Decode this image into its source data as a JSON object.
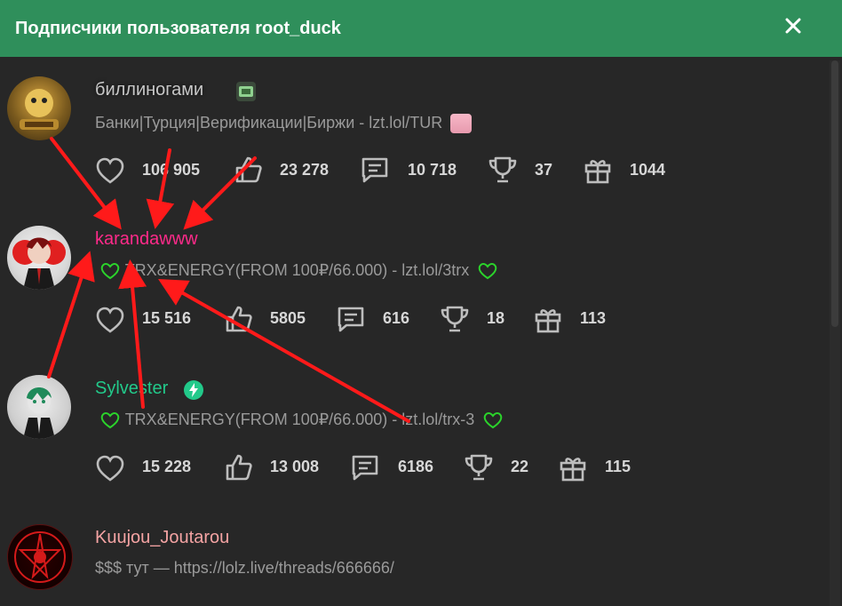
{
  "header": {
    "title": "Подписчики пользователя root_duck"
  },
  "colors": {
    "header_bg": "#2f8f5b",
    "name_gray": "#c8c8c8",
    "name_pink": "#ff2a8a",
    "name_green": "#22c98a",
    "name_salmon": "#f4a3a3",
    "stat_text": "#d7d7d7",
    "status_text": "#9a9a9a",
    "annotation_red": "#ff1a1a"
  },
  "users": [
    {
      "name": "биллиногами",
      "status": "Банки|Турция|Верификации|Биржи - lzt.lol/TUR",
      "stats": {
        "likes": "106 905",
        "thumbs": "23 278",
        "messages": "10 718",
        "trophies": "37",
        "gifts": "1044"
      }
    },
    {
      "name": "karandawww",
      "status": "TRX&ENERGY(FROM 100₽/66.000) - lzt.lol/3trx",
      "stats": {
        "likes": "15 516",
        "thumbs": "5805",
        "messages": "616",
        "trophies": "18",
        "gifts": "113"
      }
    },
    {
      "name": "Sylvester",
      "status": "TRX&ENERGY(FROM 100₽/66.000) - lzt.lol/trx-3",
      "stats": {
        "likes": "15 228",
        "thumbs": "13 008",
        "messages": "6186",
        "trophies": "22",
        "gifts": "115"
      }
    },
    {
      "name": "Kuujou_Joutarou",
      "status": "$$$ тут — https://lolz.live/threads/666666/"
    }
  ]
}
